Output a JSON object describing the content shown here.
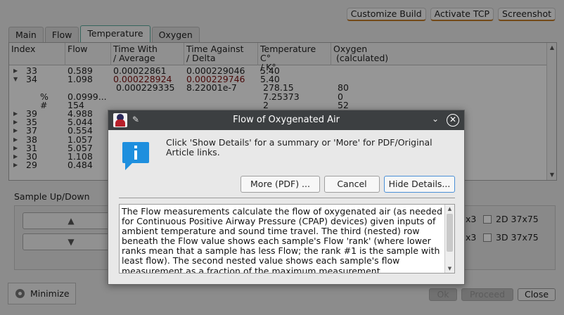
{
  "toolbar": {
    "customize_label": "Customize Build",
    "activate_label": "Activate TCP",
    "screenshot_label": "Screenshot"
  },
  "tabs": [
    {
      "label": "Main"
    },
    {
      "label": "Flow"
    },
    {
      "label": "Temperature"
    },
    {
      "label": "Oxygen"
    }
  ],
  "table": {
    "headers": [
      [
        "Index",
        ""
      ],
      [
        "Flow",
        ""
      ],
      [
        "Time With",
        "/ Average"
      ],
      [
        "Time Against",
        "/ Delta"
      ],
      [
        "Temperature C°",
        "/ K°"
      ],
      [
        "Oxygen",
        " (calculated)"
      ]
    ],
    "rows": [
      {
        "toggle": "▶",
        "index": "33",
        "flow": "0.589",
        "with": "0.00022861",
        "against": "0.000229046",
        "temp": "5.40",
        "oxy": ""
      },
      {
        "toggle": "▼",
        "index": "34",
        "flow": "1.098",
        "with": "0.000228924",
        "against": "0.000229746",
        "temp": "5.40",
        "oxy": ""
      },
      {
        "toggle": "",
        "index": "",
        "flow": "",
        "with": "0.000229335",
        "against": "8.22001e-7",
        "temp": "278.15",
        "oxy": "80"
      },
      {
        "toggle": "",
        "index": "%",
        "flow": "0.0999...",
        "with": "",
        "against": "",
        "temp": "7.25373",
        "oxy": "0"
      },
      {
        "toggle": "",
        "index": "#",
        "flow": "154",
        "with": "",
        "against": "",
        "temp": "2",
        "oxy": "52"
      },
      {
        "toggle": "▶",
        "index": "39",
        "flow": "4.988",
        "with": "",
        "against": "",
        "temp": "",
        "oxy": ""
      },
      {
        "toggle": "▶",
        "index": "35",
        "flow": "5.044",
        "with": "",
        "against": "",
        "temp": "",
        "oxy": ""
      },
      {
        "toggle": "▶",
        "index": "37",
        "flow": "0.554",
        "with": "",
        "against": "",
        "temp": "",
        "oxy": ""
      },
      {
        "toggle": "▶",
        "index": "38",
        "flow": "1.057",
        "with": "",
        "against": "",
        "temp": "",
        "oxy": ""
      },
      {
        "toggle": "▶",
        "index": "31",
        "flow": "5.057",
        "with": "",
        "against": "",
        "temp": "",
        "oxy": ""
      },
      {
        "toggle": "▶",
        "index": "30",
        "flow": "1.108",
        "with": "",
        "against": "",
        "temp": "",
        "oxy": ""
      },
      {
        "toggle": "▶",
        "index": "29",
        "flow": "0.484",
        "with": "",
        "against": "",
        "temp": "",
        "oxy": ""
      }
    ]
  },
  "sample": {
    "label": "Sample Up/Down",
    "x3_a": "x3",
    "x3_b": "x3",
    "option_2d": "2D 37x75",
    "option_3d": "3D 37x75"
  },
  "bottom": {
    "minimize_label": "Minimize",
    "ok_label": "Ok",
    "proceed_label": "Proceed",
    "close_label": "Close"
  },
  "dialog": {
    "title": "Flow of Oxygenated Air",
    "message": "Click 'Show Details' for a summary or 'More' for PDF/Original Article links.",
    "more_label": "More (PDF) ...",
    "cancel_label": "Cancel",
    "hide_label": "Hide Details...",
    "details": "The Flow measurements calculate the flow of oxygenated air (as needed for Continuous Positive Airway Pressure (CPAP) devices) given inputs of ambient temperature and sound time travel. The third (nested) row beneath the Flow value shows each sample's Flow 'rank' (where lower ranks mean that a sample has less Flow; the rank #1 is the sample with least flow). The second nested value shows each sample's flow measurement as a fraction of the maximum measurement"
  },
  "colors": {
    "titlebar": "#3c3f41",
    "accent_border": "#c07b28",
    "focus": "#4b8fd6",
    "info_blue": "#1e8fde"
  }
}
